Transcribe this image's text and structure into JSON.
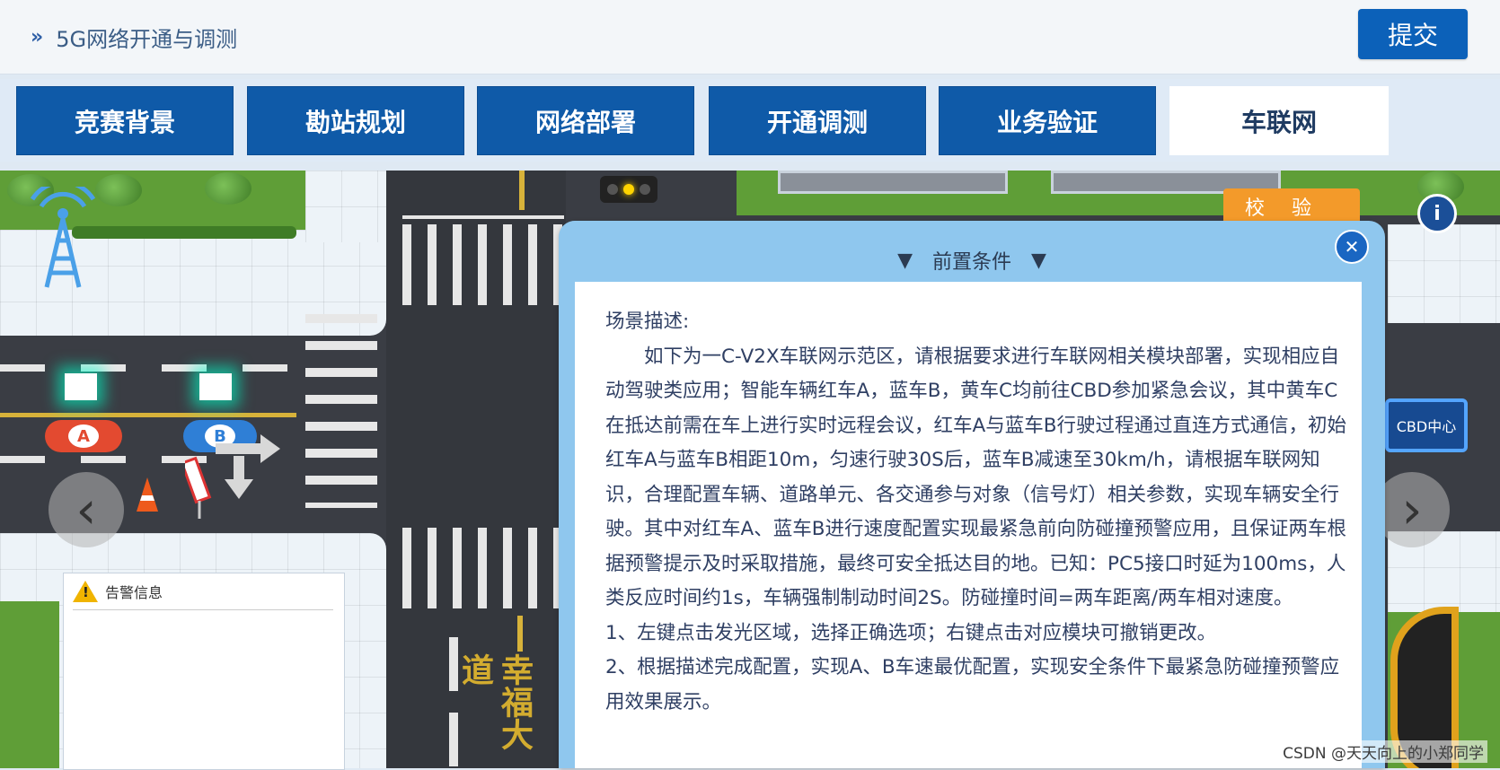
{
  "header": {
    "breadcrumb_icon": "»",
    "breadcrumb_text": "5G网络开通与调测",
    "submit_label": "提交"
  },
  "tabs": [
    {
      "label": "竞赛背景",
      "active": false
    },
    {
      "label": "勘站规划",
      "active": false
    },
    {
      "label": "网络部署",
      "active": false
    },
    {
      "label": "开通调测",
      "active": false
    },
    {
      "label": "业务验证",
      "active": false
    },
    {
      "label": "车联网",
      "active": true
    }
  ],
  "scene": {
    "verify_label": "校验",
    "info_label": "i",
    "cbd_label": "CBD中心",
    "road_label": "幸福大道",
    "car_a": "A",
    "car_b": "B",
    "prev_icon": "‹",
    "next_icon": "›"
  },
  "popup": {
    "title": "前置条件",
    "close_label": "✕",
    "section_label": "场景描述:",
    "paragraph": "如下为一C-V2X车联网示范区，请根据要求进行车联网相关模块部署，实现相应自动驾驶类应用；智能车辆红车A，蓝车B，黄车C均前往CBD参加紧急会议，其中黄车C在抵达前需在车上进行实时远程会议，红车A与蓝车B行驶过程通过直连方式通信，初始红车A与蓝车B相距10m，匀速行驶30S后，蓝车B减速至30km/h，请根据车联网知识，合理配置车辆、道路单元、各交通参与对象（信号灯）相关参数，实现车辆安全行驶。其中对红车A、蓝车B进行速度配置实现最紧急前向防碰撞预警应用，且保证两车根据预警提示及时采取措施，最终可安全抵达目的地。已知：PC5接口时延为100ms，人类反应时间约1s，车辆强制制动时间2S。防碰撞时间=两车距离/两车相对速度。",
    "step1": "1、左键点击发光区域，选择正确选项；右键点击对应模块可撤销更改。",
    "step2": "2、根据描述完成配置，实现A、B车速最优配置，实现安全条件下最紧急防碰撞预警应用效果展示。"
  },
  "alarm": {
    "title": "告警信息"
  },
  "watermark": "CSDN @天天向上的小郑同学",
  "colors": {
    "tab_blue": "#0f5aa8",
    "submit_blue": "#0c61b9",
    "verify_orange": "#f39a2a",
    "popup_frame": "#8fc7ee"
  }
}
